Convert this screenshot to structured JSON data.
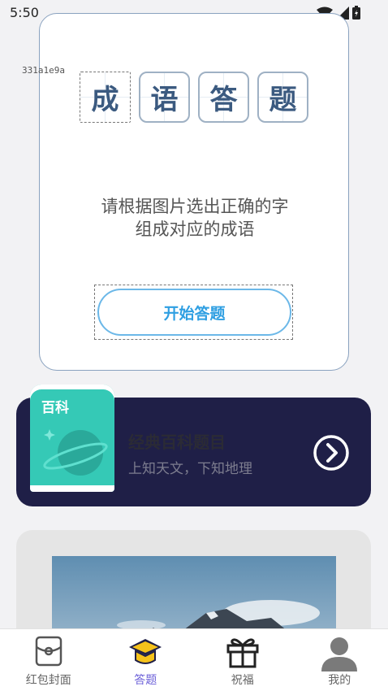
{
  "status_bar": {
    "time": "5:50"
  },
  "debug_id": "331a1e9a",
  "quiz": {
    "title_chars": [
      "成",
      "语",
      "答",
      "题"
    ],
    "instruction_line1": "请根据图片选出正确的字",
    "instruction_line2": "组成对应的成语",
    "start_label": "开始答题"
  },
  "baike": {
    "book_label": "百科",
    "title": "经典百科题目",
    "subtitle": "上知天文，下知地理"
  },
  "nav": {
    "items": [
      {
        "label": "红包封面",
        "icon": "red-envelope-icon",
        "active": false
      },
      {
        "label": "答题",
        "icon": "graduation-cap-icon",
        "active": true
      },
      {
        "label": "祝福",
        "icon": "gift-icon",
        "active": false
      },
      {
        "label": "我的",
        "icon": "person-icon",
        "active": false
      }
    ]
  },
  "colors": {
    "accent": "#2f9fe2",
    "banner_bg": "#1f1f47",
    "book_teal": "#35c9b6",
    "nav_active": "#6b5fd8"
  }
}
